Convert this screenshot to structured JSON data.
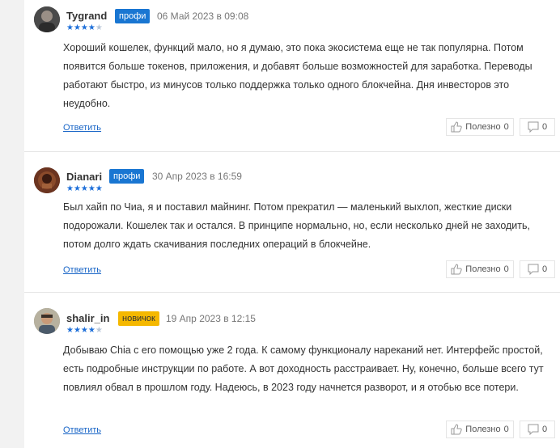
{
  "reviews": [
    {
      "author": "Tygrand",
      "badge": "профи",
      "date": "06 Май 2023 в 09:08",
      "rating": 4,
      "text": "Хороший кошелек, функций мало, но я думаю, это пока экосистема еще не так популярна. Потом появится больше токенов, приложения, и добавят больше возможностей для заработка. Переводы работают быстро, из минусов только поддержка только одного блокчейна. Дня инвесторов это неудобно.",
      "reply": "Ответить",
      "useful_label": "Полезно",
      "useful_count": "0",
      "comments_count": "0"
    },
    {
      "author": "Dianari",
      "badge": "профи",
      "date": "30 Апр 2023 в 16:59",
      "rating": 5,
      "text": "Был хайп по Чиа, я и поставил майнинг. Потом прекратил — маленький выхлоп, жесткие диски подорожали. Кошелек так и остался. В принципе нормально, но, если несколько дней не заходить, потом долго ждать скачивания последних операций в блокчейне.",
      "reply": "Ответить",
      "useful_label": "Полезно",
      "useful_count": "0",
      "comments_count": "0"
    },
    {
      "author": "shalir_in",
      "badge": "новичок",
      "date": "19 Апр 2023 в 12:15",
      "rating": 4,
      "text": "Добываю Chia с его помощью уже 2 года. К самому функционалу нареканий нет. Интерфейс простой, есть подробные инструкции по работе. А вот доходность расстраивает. Ну, конечно, больше всего тут повлиял обвал в прошлом году. Надеюсь, в 2023 году начнется разворот, и я отобью все потери.",
      "reply": "Ответить",
      "useful_label": "Полезно",
      "useful_count": "0",
      "comments_count": "0"
    }
  ],
  "colors": {
    "accent": "#1a66c7",
    "badge_pro": "#1976d2",
    "badge_newbie": "#f5b800",
    "star": "#1e6fd9"
  }
}
